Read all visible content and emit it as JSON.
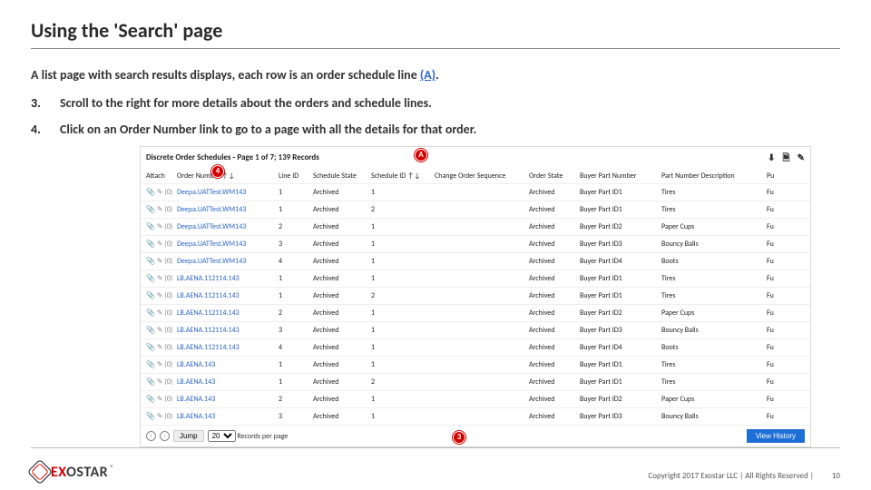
{
  "title": "Using the 'Search' page",
  "intro_prefix": "A list page with search results displays, each row is an order schedule line ",
  "intro_link": "(A)",
  "intro_suffix": ".",
  "steps": [
    {
      "num": "3.",
      "text": "Scroll to the right for more details about the orders and schedule lines."
    },
    {
      "num": "4.",
      "text": "Click on an Order Number link to go to a page with all the details for that order."
    }
  ],
  "shot": {
    "heading": "Discrete Order Schedules - Page 1 of 7; 139 Records",
    "columns": {
      "attach": "Attach",
      "orderno": "Order Number ↑↓",
      "lineid": "Line ID",
      "schstate": "Schedule State",
      "schid": "Schedule ID ↑↓",
      "chgseq": "Change Order Sequence",
      "ordstate": "Order State",
      "bpn": "Buyer Part Number",
      "pdesc": "Part Number Description",
      "last": "Pu"
    },
    "rows": [
      {
        "attach": "📎 ✎ (0)",
        "order": "Deepa.UATTest.WM143",
        "line": "1",
        "sch": "Archived",
        "sid": "1",
        "seq": "",
        "ost": "Archived",
        "bpn": "Buyer Part ID1",
        "pd": "Tires",
        "last": "Fu"
      },
      {
        "attach": "📎 ✎ (0)",
        "order": "Deepa.UATTest.WM143",
        "line": "1",
        "sch": "Archived",
        "sid": "2",
        "seq": "",
        "ost": "Archived",
        "bpn": "Buyer Part ID1",
        "pd": "Tires",
        "last": "Fu"
      },
      {
        "attach": "📎 ✎ (0)",
        "order": "Deepa.UATTest.WM143",
        "line": "2",
        "sch": "Archived",
        "sid": "1",
        "seq": "",
        "ost": "Archived",
        "bpn": "Buyer Part ID2",
        "pd": "Paper Cups",
        "last": "Fu"
      },
      {
        "attach": "📎 ✎ (0)",
        "order": "Deepa.UATTest.WM143",
        "line": "3",
        "sch": "Archived",
        "sid": "1",
        "seq": "",
        "ost": "Archived",
        "bpn": "Buyer Part ID3",
        "pd": "Bouncy Balls",
        "last": "Fu"
      },
      {
        "attach": "📎 ✎ (0)",
        "order": "Deepa.UATTest.WM143",
        "line": "4",
        "sch": "Archived",
        "sid": "1",
        "seq": "",
        "ost": "Archived",
        "bpn": "Buyer Part ID4",
        "pd": "Boots",
        "last": "Fu"
      },
      {
        "attach": "📎 ✎ (0)",
        "order": "LB.AENA.112114.143",
        "line": "1",
        "sch": "Archived",
        "sid": "1",
        "seq": "",
        "ost": "Archived",
        "bpn": "Buyer Part ID1",
        "pd": "Tires",
        "last": "Fu"
      },
      {
        "attach": "📎 ✎ (0)",
        "order": "LB.AENA.112114.143",
        "line": "1",
        "sch": "Archived",
        "sid": "2",
        "seq": "",
        "ost": "Archived",
        "bpn": "Buyer Part ID1",
        "pd": "Tires",
        "last": "Fu"
      },
      {
        "attach": "📎 ✎ (0)",
        "order": "LB.AENA.112114.143",
        "line": "2",
        "sch": "Archived",
        "sid": "1",
        "seq": "",
        "ost": "Archived",
        "bpn": "Buyer Part ID2",
        "pd": "Paper Cups",
        "last": "Fu"
      },
      {
        "attach": "📎 ✎ (0)",
        "order": "LB.AENA.112114.143",
        "line": "3",
        "sch": "Archived",
        "sid": "1",
        "seq": "",
        "ost": "Archived",
        "bpn": "Buyer Part ID3",
        "pd": "Bouncy Balls",
        "last": "Fu"
      },
      {
        "attach": "📎 ✎ (0)",
        "order": "LB.AENA.112114.143",
        "line": "4",
        "sch": "Archived",
        "sid": "1",
        "seq": "",
        "ost": "Archived",
        "bpn": "Buyer Part ID4",
        "pd": "Boots",
        "last": "Fu"
      },
      {
        "attach": "📎 ✎ (0)",
        "order": "LB.AENA.143",
        "line": "1",
        "sch": "Archived",
        "sid": "1",
        "seq": "",
        "ost": "Archived",
        "bpn": "Buyer Part ID1",
        "pd": "Tires",
        "last": "Fu"
      },
      {
        "attach": "📎 ✎ (0)",
        "order": "LB.AENA.143",
        "line": "1",
        "sch": "Archived",
        "sid": "2",
        "seq": "",
        "ost": "Archived",
        "bpn": "Buyer Part ID1",
        "pd": "Tires",
        "last": "Fu"
      },
      {
        "attach": "📎 ✎ (0)",
        "order": "LB.AENA.143",
        "line": "2",
        "sch": "Archived",
        "sid": "1",
        "seq": "",
        "ost": "Archived",
        "bpn": "Buyer Part ID2",
        "pd": "Paper Cups",
        "last": "Fu"
      },
      {
        "attach": "📎 ✎ (0)",
        "order": "LB.AENA.143",
        "line": "3",
        "sch": "Archived",
        "sid": "1",
        "seq": "",
        "ost": "Archived",
        "bpn": "Buyer Part ID3",
        "pd": "Bouncy Balls",
        "last": "Fu"
      }
    ],
    "pager": {
      "jump": "Jump",
      "records": "20",
      "perpage": "Records per page",
      "viewhist": "View History"
    },
    "callouts": {
      "a": "A",
      "c4": "4",
      "c3": "3"
    }
  },
  "footer": {
    "brand_ex": "EX",
    "brand_o": "O",
    "brand_star": "STAR",
    "copy": "Copyright 2017 Exostar LLC | All Rights Reserved |",
    "page": "10"
  }
}
